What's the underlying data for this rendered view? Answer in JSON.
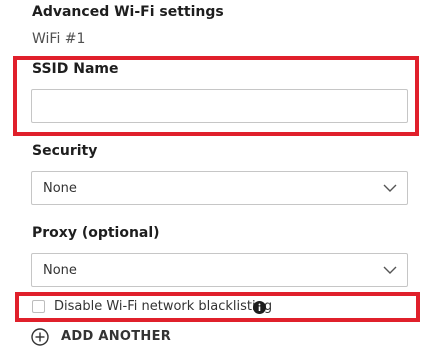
{
  "header": {
    "title": "Advanced Wi-Fi settings",
    "subtitle": "WiFi #1"
  },
  "ssid": {
    "label": "SSID Name",
    "value": "",
    "placeholder": ""
  },
  "security": {
    "label": "Security",
    "selected": "None"
  },
  "proxy": {
    "label": "Proxy (optional)",
    "selected": "None"
  },
  "blacklist": {
    "label": "Disable Wi-Fi network blacklisting",
    "checked": false,
    "info_icon": "info-icon"
  },
  "add_another": {
    "label": "ADD ANOTHER",
    "icon": "plus-circle-icon"
  },
  "colors": {
    "highlight": "#e0202b",
    "border": "#c6c6c6",
    "text": "#1e1e1e"
  }
}
